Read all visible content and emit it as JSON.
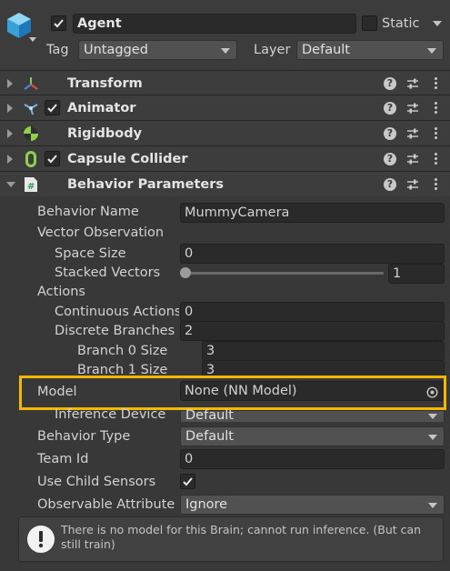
{
  "gameobject": {
    "name": "Agent",
    "static_label": "Static",
    "tag_label": "Tag",
    "tag_value": "Untagged",
    "layer_label": "Layer",
    "layer_value": "Default",
    "active": true
  },
  "components": [
    {
      "title": "Transform",
      "icon": "transform-icon"
    },
    {
      "title": "Animator",
      "icon": "animator-icon"
    },
    {
      "title": "Rigidbody",
      "icon": "rigidbody-icon"
    },
    {
      "title": "Capsule Collider",
      "icon": "capsule-collider-icon"
    },
    {
      "title": "Behavior Parameters",
      "icon": "script-icon"
    }
  ],
  "behavior": {
    "behavior_name_label": "Behavior Name",
    "behavior_name_value": "MummyCamera",
    "vector_observation_label": "Vector Observation",
    "space_size_label": "Space Size",
    "space_size_value": "0",
    "stacked_vectors_label": "Stacked Vectors",
    "stacked_vectors_value": "1",
    "stacked_vectors_slider_fraction": 0,
    "actions_label": "Actions",
    "continuous_actions_label": "Continuous Actions",
    "continuous_actions_value": "0",
    "discrete_branches_label": "Discrete Branches",
    "discrete_branches_value": "2",
    "branch0_label": "Branch 0 Size",
    "branch0_value": "3",
    "branch1_label": "Branch 1 Size",
    "branch1_value": "3",
    "model_label": "Model",
    "model_value": "None (NN Model)",
    "inference_device_label": "Inference Device",
    "inference_device_value": "Default",
    "behavior_type_label": "Behavior Type",
    "behavior_type_value": "Default",
    "team_id_label": "Team Id",
    "team_id_value": "0",
    "use_child_sensors_label": "Use Child Sensors",
    "use_child_sensors_checked": true,
    "observable_attribute_label": "Observable Attribute Handling",
    "observable_attribute_value": "Ignore"
  },
  "warning": {
    "message": "There is no model for this Brain; cannot run inference. (But can still train)"
  },
  "colors": {
    "highlight": "#f5b800",
    "background": "#383838"
  }
}
